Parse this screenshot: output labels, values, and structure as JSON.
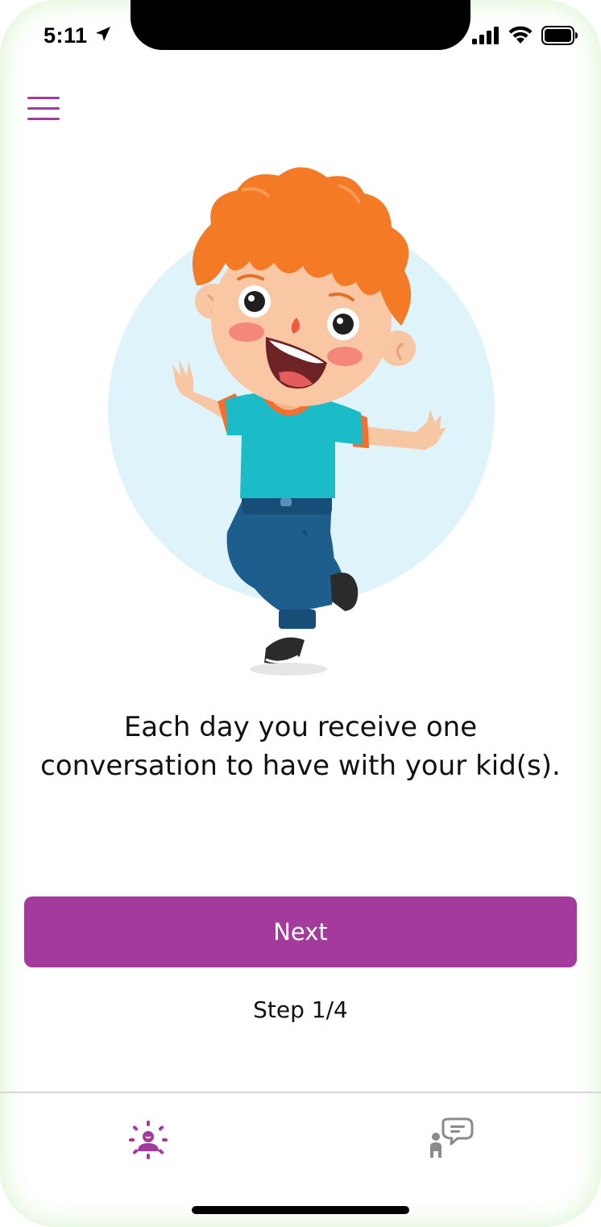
{
  "status_bar": {
    "time": "5:11",
    "location_icon": "location-arrow-icon",
    "signal_icon": "cellular-signal-icon",
    "wifi_icon": "wifi-icon",
    "battery_icon": "battery-icon"
  },
  "header": {
    "menu_icon": "hamburger-menu-icon"
  },
  "onboarding": {
    "illustration": "happy-boy-illustration",
    "caption_line1": "Each day you receive one",
    "caption_line2": "conversation to have with your kid(s).",
    "next_label": "Next",
    "step_label": "Step 1/4"
  },
  "tab_bar": {
    "tabs": [
      {
        "icon": "daily-spotlight-icon",
        "active": true
      },
      {
        "icon": "kid-conversation-icon",
        "active": false
      }
    ]
  },
  "colors": {
    "accent": "#a53a9d",
    "tab_inactive": "#8a8a8a",
    "text": "#111111"
  }
}
